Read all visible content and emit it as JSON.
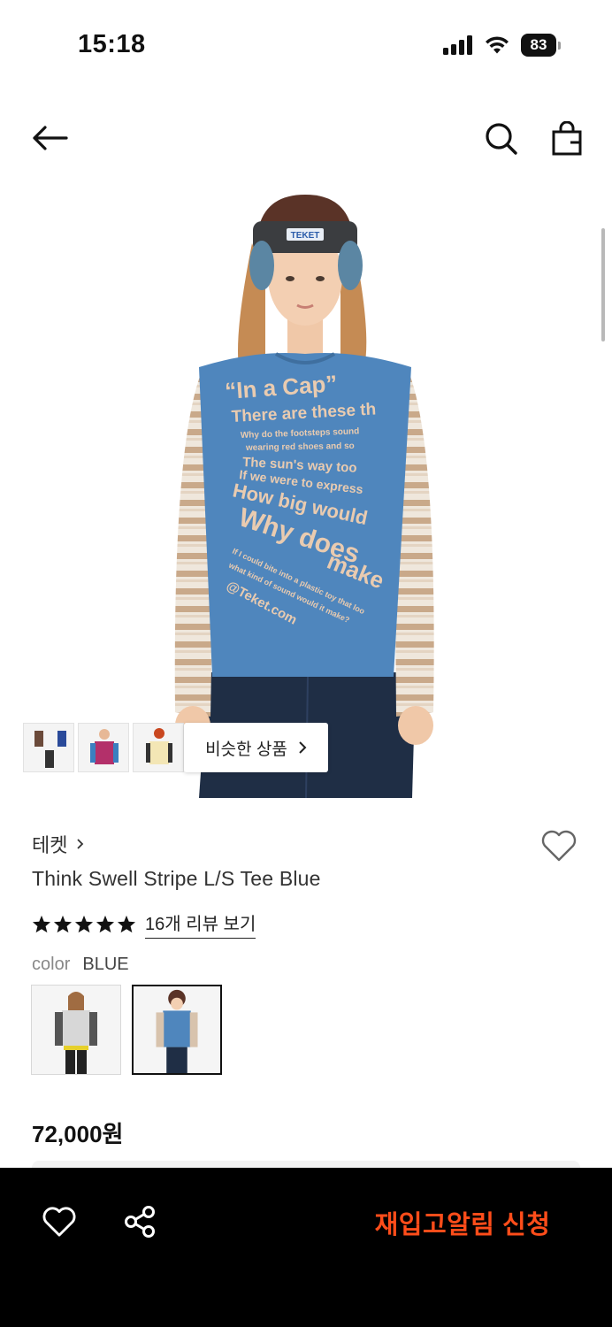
{
  "status_bar": {
    "time": "15:18",
    "battery_level": "83"
  },
  "nav": {
    "back_icon": "arrow-left-icon",
    "search_icon": "search-icon",
    "bag_icon": "shopping-bag-icon"
  },
  "hero": {
    "shirt_text": [
      "“In a Cap”",
      "There are these th",
      "Why do the footsteps sound",
      "wearing red shoes and so",
      "The sun's way too",
      "If we were to express",
      "How big would",
      "Why does",
      "make",
      "If I could bite into a plastic toy that loo",
      "what kind of sound would it make?",
      "@Teket.com"
    ],
    "cap_patch_text": "TEKET"
  },
  "similar": {
    "button_label": "비슷한 상품",
    "chevron_icon": "chevron-right-icon"
  },
  "product": {
    "brand": "테켓",
    "brand_chevron_icon": "chevron-right-icon",
    "name": "Think Swell Stripe L/S Tee Blue",
    "rating_stars": 5,
    "review_link": "16개 리뷰 보기",
    "color_label": "color",
    "color_value": "BLUE",
    "price": "72,000원"
  },
  "bottom_bar": {
    "like_icon": "heart-icon",
    "share_icon": "share-icon",
    "restock_label": "재입고알림 신청"
  },
  "colors": {
    "accent": "#ff4d1a",
    "shirt_blue": "#4f86bd",
    "bar_bg": "#000000"
  }
}
